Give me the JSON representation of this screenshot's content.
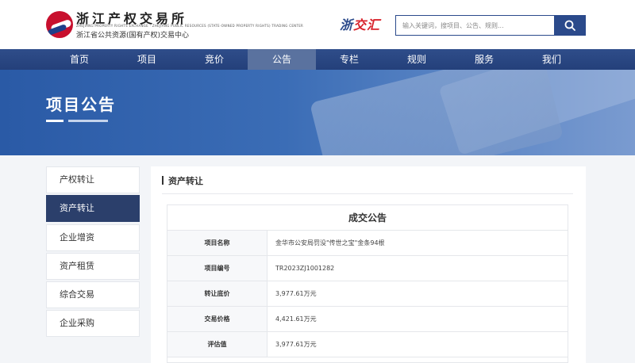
{
  "header": {
    "logo_name": "浙江产权交易所",
    "logo_en": "ZHEJIANG PROPERTY RIGHTS EXCHANGE · ZHEJIANG PUBLIC RESOURCES (STATE-OWNED PROPERTY RIGHTS) TRADING CENTER",
    "logo_sub": "浙江省公共资源(国有产权)交易中心",
    "brand_part1": "浙",
    "brand_part2": "交汇",
    "search_placeholder": "输入关键词，搜项目、公告、规则..."
  },
  "nav": {
    "items": [
      "首页",
      "项目",
      "竞价",
      "公告",
      "专栏",
      "规则",
      "服务",
      "我们"
    ],
    "active_index": 3
  },
  "banner": {
    "title": "项目公告"
  },
  "sidebar": {
    "items": [
      "产权转让",
      "资产转让",
      "企业增资",
      "资产租赁",
      "综合交易",
      "企业采购"
    ],
    "active_index": 1
  },
  "main": {
    "section_title": "资产转让",
    "notice": {
      "title": "成交公告",
      "rows": [
        {
          "label": "项目名称",
          "value": "金华市公安局罚没\"传世之宝\"金条94根"
        },
        {
          "label": "项目编号",
          "value": "TR2023ZJ1001282"
        },
        {
          "label": "转让底价",
          "value": "3,977.61万元"
        },
        {
          "label": "交易价格",
          "value": "4,421.61万元"
        },
        {
          "label": "评估值",
          "value": "3,977.61万元"
        }
      ]
    }
  },
  "colors": {
    "primary_blue": "#2b4a8b",
    "nav_active": "#5a729f",
    "sidebar_active": "#2b3f6b",
    "logo_red": "#c8102e"
  }
}
